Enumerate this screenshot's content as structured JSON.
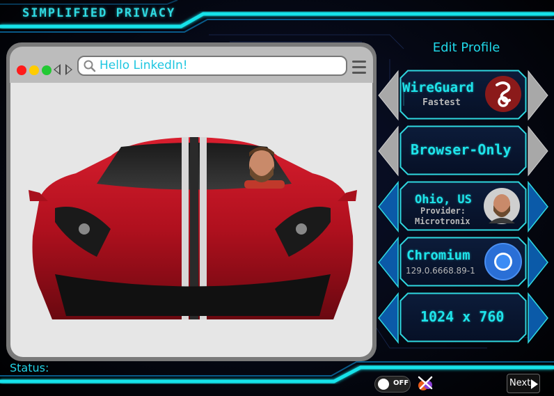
{
  "app": {
    "brand": "SIMPLIFIED PRIVACY"
  },
  "browser": {
    "url_text": "Hello LinkedIn!"
  },
  "sidebar": {
    "edit_profile": "Edit Profile",
    "rows": [
      {
        "title": "WireGuard",
        "subtitle": "Fastest",
        "icon": "wireguard-logo"
      },
      {
        "title": "Browser-Only"
      },
      {
        "title": "Ohio, US",
        "subtitle1": "Provider:",
        "subtitle2": "Microtronix",
        "icon": "avatar"
      },
      {
        "title": "Chromium",
        "subtitle": "129.0.6668.89-1",
        "icon": "chromium-logo"
      },
      {
        "title": "1024 x 760"
      }
    ]
  },
  "footer": {
    "status_label": "Status:",
    "toggle_label": "OFF",
    "next_label": "Next"
  },
  "colors": {
    "accent": "#1ee4ea",
    "panel_border": "#2fd8e0",
    "grey_arrow": "#a8a8a8",
    "blue_arrow": "#0b5aa8"
  }
}
